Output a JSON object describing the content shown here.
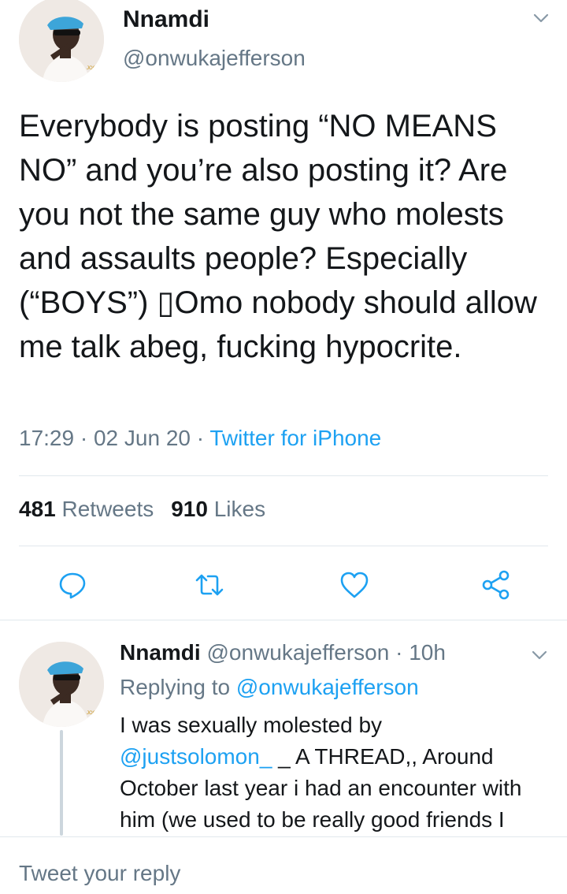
{
  "main_tweet": {
    "name": "Nnamdi",
    "handle": "@onwukajefferson",
    "text": "Everybody is posting “NO MEANS NO” and you’re also posting it? Are you not the same guy who molests and assaults people? Especially (“BOYS”) ▯Omo nobody should allow me talk abeg, fucking hypocrite.",
    "time": "17:29",
    "separator": "·",
    "date": "02 Jun 20",
    "source": "Twitter for iPhone",
    "retweet_count": "481",
    "retweet_label": "Retweets",
    "like_count": "910",
    "like_label": "Likes"
  },
  "actions": {
    "reply_icon": "reply-icon",
    "retweet_icon": "retweet-icon",
    "like_icon": "heart-icon",
    "share_icon": "share-icon"
  },
  "reply_tweet": {
    "name": "Nnamdi",
    "handle": "@onwukajefferson",
    "separator": "·",
    "age": "10h",
    "replying_label": "Replying to",
    "replying_to": "@onwukajefferson",
    "text_line1": "I was sexually molested by",
    "mention": "@justsolomon_",
    "text_rest": " _ A THREAD,, Around October last year i had an encounter with him (we used to be really good friends I"
  },
  "reply_box": {
    "placeholder": "Tweet your reply"
  },
  "colors": {
    "text": "#14171a",
    "secondary": "#657786",
    "accent": "#1da1f2",
    "divider": "#e1e8ed"
  }
}
